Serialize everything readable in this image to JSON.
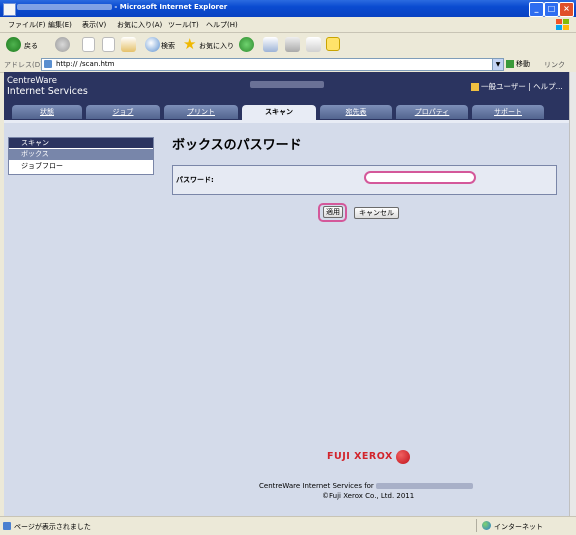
{
  "browser": {
    "title_suffix": " - Microsoft Internet Explorer",
    "menu": [
      "ファイル(F)",
      "編集(E)",
      "表示(V)",
      "お気に入り(A)",
      "ツール(T)",
      "ヘルプ(H)"
    ],
    "toolbar": {
      "back": "戻る",
      "search": "検索",
      "favorites": "お気に入り"
    },
    "address_label": "アドレス(D)",
    "address_url": "http://              /scan.htm",
    "go": "移動",
    "links": "リンク",
    "minimize": "_",
    "maximize": "□",
    "close": "×"
  },
  "app": {
    "brand_line1": "CentreWare",
    "brand_line2": "Internet Services",
    "user": "一般ユーザー | ヘルプ..."
  },
  "tabs": [
    "状態",
    "ジョブ",
    "プリント",
    "スキャン",
    "宛先表",
    "プロパティ",
    "サポート"
  ],
  "active_tab": "スキャン",
  "sidebar": {
    "heading": "スキャン",
    "items": [
      "ボックス",
      "ジョブフロー"
    ]
  },
  "main": {
    "heading": "ボックスのパスワード",
    "password_label": "パスワード:",
    "password_value": "",
    "apply": "適用",
    "cancel": "キャンセル"
  },
  "footer": {
    "logo": "FUJI XEROX",
    "line1": "CentreWare Internet Services for ",
    "line2": "©Fuji Xerox Co., Ltd. 2011"
  },
  "status": {
    "text": "ページが表示されました",
    "zone": "インターネット"
  },
  "colors": {
    "header": "#2b3460",
    "page_bg": "#d4dbea",
    "highlight": "#d4589a",
    "brand_red": "#d2242c"
  }
}
